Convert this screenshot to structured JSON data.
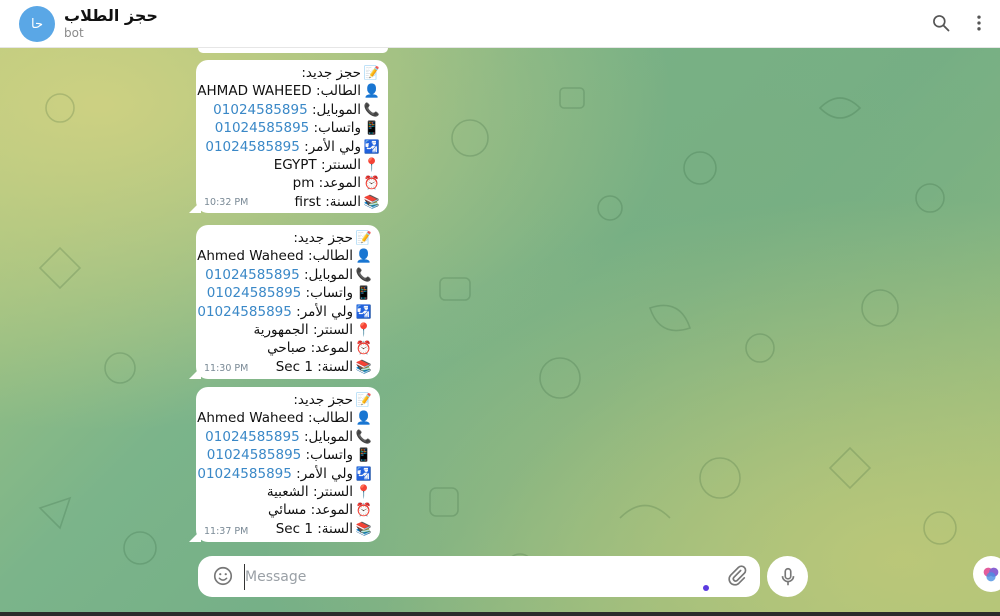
{
  "header": {
    "avatar_text": "حا",
    "title": "حجز الطلاب",
    "subtitle": "bot",
    "search_icon": "search-icon",
    "menu_icon": "more-vert-icon"
  },
  "messages": [
    {
      "lines": [
        {
          "emoji": "📝",
          "label": "حجز جديد:",
          "value": ""
        },
        {
          "emoji": "👤",
          "label": "الطالب:",
          "value": "AHMAD WAHEED"
        },
        {
          "emoji": "📞",
          "label": "الموبايل:",
          "value": "01024585895"
        },
        {
          "emoji": "📱",
          "label": "واتساب:",
          "value": "01024585895"
        },
        {
          "emoji": "🛂",
          "label": "ولي الأمر:",
          "value": "01024585895"
        },
        {
          "emoji": "📍",
          "label": "السنتر:",
          "value": "EGYPT"
        },
        {
          "emoji": "⏰",
          "label": "الموعد:",
          "value": "pm"
        },
        {
          "emoji": "📚",
          "label": "السنة:",
          "value": "first"
        }
      ],
      "time": "10:32 PM"
    },
    {
      "lines": [
        {
          "emoji": "📝",
          "label": "حجز جديد:",
          "value": ""
        },
        {
          "emoji": "👤",
          "label": "الطالب:",
          "value": "Ahmed Waheed"
        },
        {
          "emoji": "📞",
          "label": "الموبايل:",
          "value": "01024585895"
        },
        {
          "emoji": "📱",
          "label": "واتساب:",
          "value": "01024585895"
        },
        {
          "emoji": "🛂",
          "label": "ولي الأمر:",
          "value": "01024585895"
        },
        {
          "emoji": "📍",
          "label": "السنتر:",
          "value": "الجمهورية"
        },
        {
          "emoji": "⏰",
          "label": "الموعد:",
          "value": "صباحي"
        },
        {
          "emoji": "📚",
          "label": "السنة:",
          "value": "Sec 1"
        }
      ],
      "time": "11:30 PM"
    },
    {
      "lines": [
        {
          "emoji": "📝",
          "label": "حجز جديد:",
          "value": ""
        },
        {
          "emoji": "👤",
          "label": "الطالب:",
          "value": "Ahmed Waheed"
        },
        {
          "emoji": "📞",
          "label": "الموبايل:",
          "value": "01024585895"
        },
        {
          "emoji": "📱",
          "label": "واتساب:",
          "value": "01024585895"
        },
        {
          "emoji": "🛂",
          "label": "ولي الأمر:",
          "value": "01024585895"
        },
        {
          "emoji": "📍",
          "label": "السنتر:",
          "value": "الشعبية"
        },
        {
          "emoji": "⏰",
          "label": "الموعد:",
          "value": "مسائي"
        },
        {
          "emoji": "📚",
          "label": "السنة:",
          "value": "Sec 1"
        }
      ],
      "time": "11:37 PM"
    }
  ],
  "composer": {
    "placeholder": "Message",
    "emoji_icon": "smile-icon",
    "attach_icon": "paperclip-icon",
    "mic_icon": "microphone-icon",
    "extra_icon": "brain-icon"
  },
  "colors": {
    "link": "#3a88c7",
    "avatar": "#5aa7e6",
    "time": "#7a8a96"
  }
}
